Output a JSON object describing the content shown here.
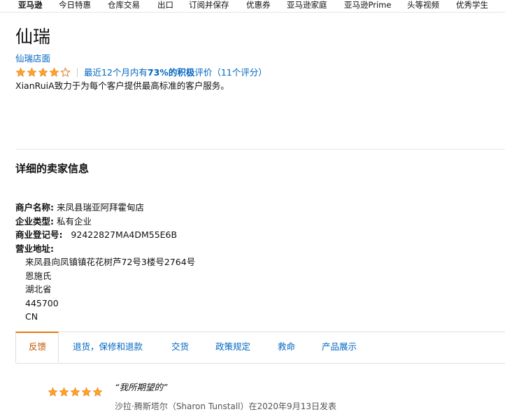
{
  "nav": {
    "items": [
      "亚马逊",
      "今日特惠",
      "仓库交易",
      "出口",
      "订阅并保存",
      "优惠券",
      "亚马逊家庭",
      "亚马逊Prime",
      "头等视频",
      "优秀学生"
    ]
  },
  "seller": {
    "name": "仙瑞",
    "store_link": "仙瑞店面",
    "rating_stars": 4,
    "rating_text_prefix": "最近12个月内有",
    "rating_percent": "73%的积极",
    "rating_text_suffix": "评价（11个评分）",
    "description": "XianRuiA致力于为每个客户提供最高标准的客户服务。"
  },
  "details": {
    "title": "详细的卖家信息",
    "business_name_label": "商户名称:",
    "business_name": "来凤县瑞亚阿拜霍甸店",
    "company_type_label": "企业类型:",
    "company_type": "私有企业",
    "registration_label": "商业登记号:",
    "registration": "92422827MA4DM55E6B",
    "address_label": "营业地址:",
    "address_lines": [
      "来凤县向凤镇镇花花树芦72号3楼号2764号",
      "恩施氏",
      "湖北省",
      "445700",
      "CN"
    ]
  },
  "tabs": [
    "反馈",
    "退货，保修和退款",
    "交货",
    "政策规定",
    "救命",
    "产品展示"
  ],
  "review": {
    "stars": 5,
    "quote": "“我所期望的”",
    "meta": "沙拉·腾斯塔尔（Sharon Tunstall）在2020年9月13日发表"
  },
  "colors": {
    "link": "#0066c0",
    "star": "#ffa41c",
    "active_tab": "#c45500",
    "tab_accent": "#e47911"
  }
}
